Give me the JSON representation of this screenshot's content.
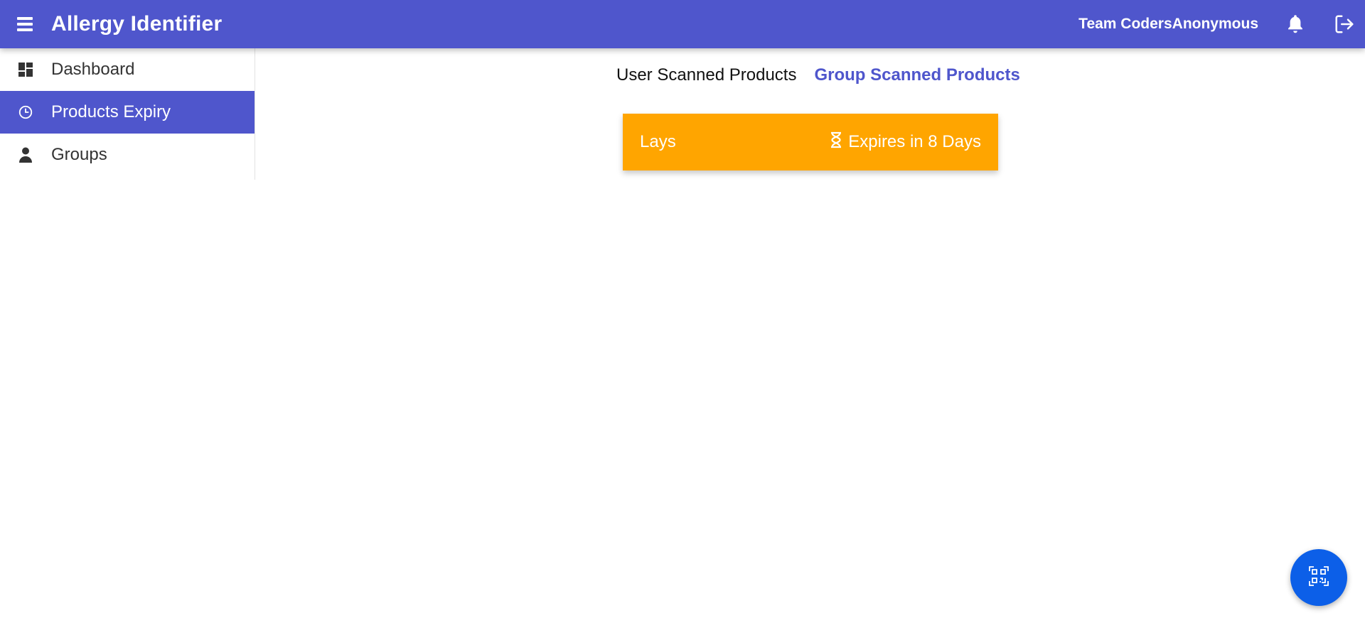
{
  "header": {
    "menu_icon": "hamburger-menu-icon",
    "title": "Allergy Identifier",
    "team_name": "Team CodersAnonymous",
    "notification_icon": "bell-icon",
    "logout_icon": "logout-icon"
  },
  "sidebar": {
    "items": [
      {
        "label": "Dashboard",
        "icon": "dashboard-grid-icon",
        "active": false
      },
      {
        "label": "Products Expiry",
        "icon": "clock-icon",
        "active": true
      },
      {
        "label": "Groups",
        "icon": "person-icon",
        "active": false
      }
    ]
  },
  "tabs": {
    "user_label": "User Scanned Products",
    "group_label": "Group Scanned Products",
    "active": "group"
  },
  "products": [
    {
      "name": "Lays",
      "expiry_text": "Expires in 8 Days",
      "icon": "hourglass-icon"
    }
  ],
  "fab": {
    "icon": "qr-code-scan-icon"
  },
  "colors": {
    "primary": "#4f56cc",
    "card": "#ffa500",
    "fab": "#0c5fe8"
  }
}
